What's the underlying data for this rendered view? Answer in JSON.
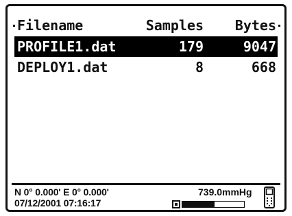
{
  "table": {
    "headers": {
      "filename": "Filename",
      "samples": "Samples",
      "bytes": "Bytes"
    },
    "rows": [
      {
        "filename": "PROFILE1.dat",
        "samples": "179",
        "bytes": "9047",
        "selected": true
      },
      {
        "filename": "DEPLOY1.dat",
        "samples": "8",
        "bytes": "668",
        "selected": false
      }
    ]
  },
  "status": {
    "gps": "N 0° 0.000' E  0° 0.000'",
    "datetime": "07/12/2001 07:16:17",
    "pressure": "739.0mmHg",
    "battery_level": 0.52,
    "device_icon": "handheld-device-icon"
  }
}
